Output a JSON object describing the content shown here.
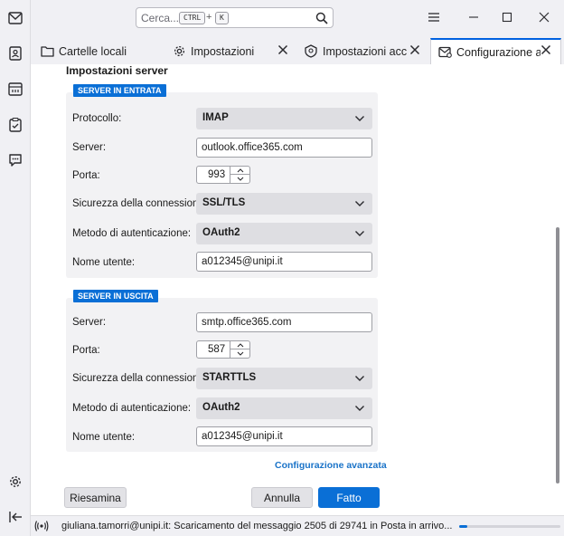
{
  "search": {
    "placeholder": "Cerca...",
    "key1": "CTRL",
    "plus": "+",
    "key2": "K"
  },
  "tabs": [
    {
      "label": "Cartelle locali",
      "icon": "folder-icon"
    },
    {
      "label": "Impostazioni",
      "icon": "gear-icon"
    },
    {
      "label": "Impostazioni account",
      "icon": "shield-icon"
    },
    {
      "label": "Configurazione account",
      "icon": "mail-settings-icon"
    }
  ],
  "section_title": "Impostazioni server",
  "incoming": {
    "badge": "SERVER IN ENTRATA",
    "protocol_label": "Protocollo:",
    "protocol_value": "IMAP",
    "server_label": "Server:",
    "server_value": "outlook.office365.com",
    "port_label": "Porta:",
    "port_value": "993",
    "security_label": "Sicurezza della connessione:",
    "security_value": "SSL/TLS",
    "auth_label": "Metodo di autenticazione:",
    "auth_value": "OAuth2",
    "user_label": "Nome utente:",
    "user_value": "a012345@unipi.it"
  },
  "outgoing": {
    "badge": "SERVER IN USCITA",
    "server_label": "Server:",
    "server_value": "smtp.office365.com",
    "port_label": "Porta:",
    "port_value": "587",
    "security_label": "Sicurezza della connessione:",
    "security_value": "STARTTLS",
    "auth_label": "Metodo di autenticazione:",
    "auth_value": "OAuth2",
    "user_label": "Nome utente:",
    "user_value": "a012345@unipi.it"
  },
  "advanced_link": "Configurazione avanzata",
  "buttons": {
    "review": "Riesamina",
    "cancel": "Annulla",
    "done": "Fatto"
  },
  "status": {
    "text": "giuliana.tamorri@unipi.it: Scaricamento del messaggio 2505 di 29741 in Posta in arrivo...",
    "progress": 0.08
  },
  "colors": {
    "accent": "#0a6fd6",
    "link": "#1a73c8"
  }
}
